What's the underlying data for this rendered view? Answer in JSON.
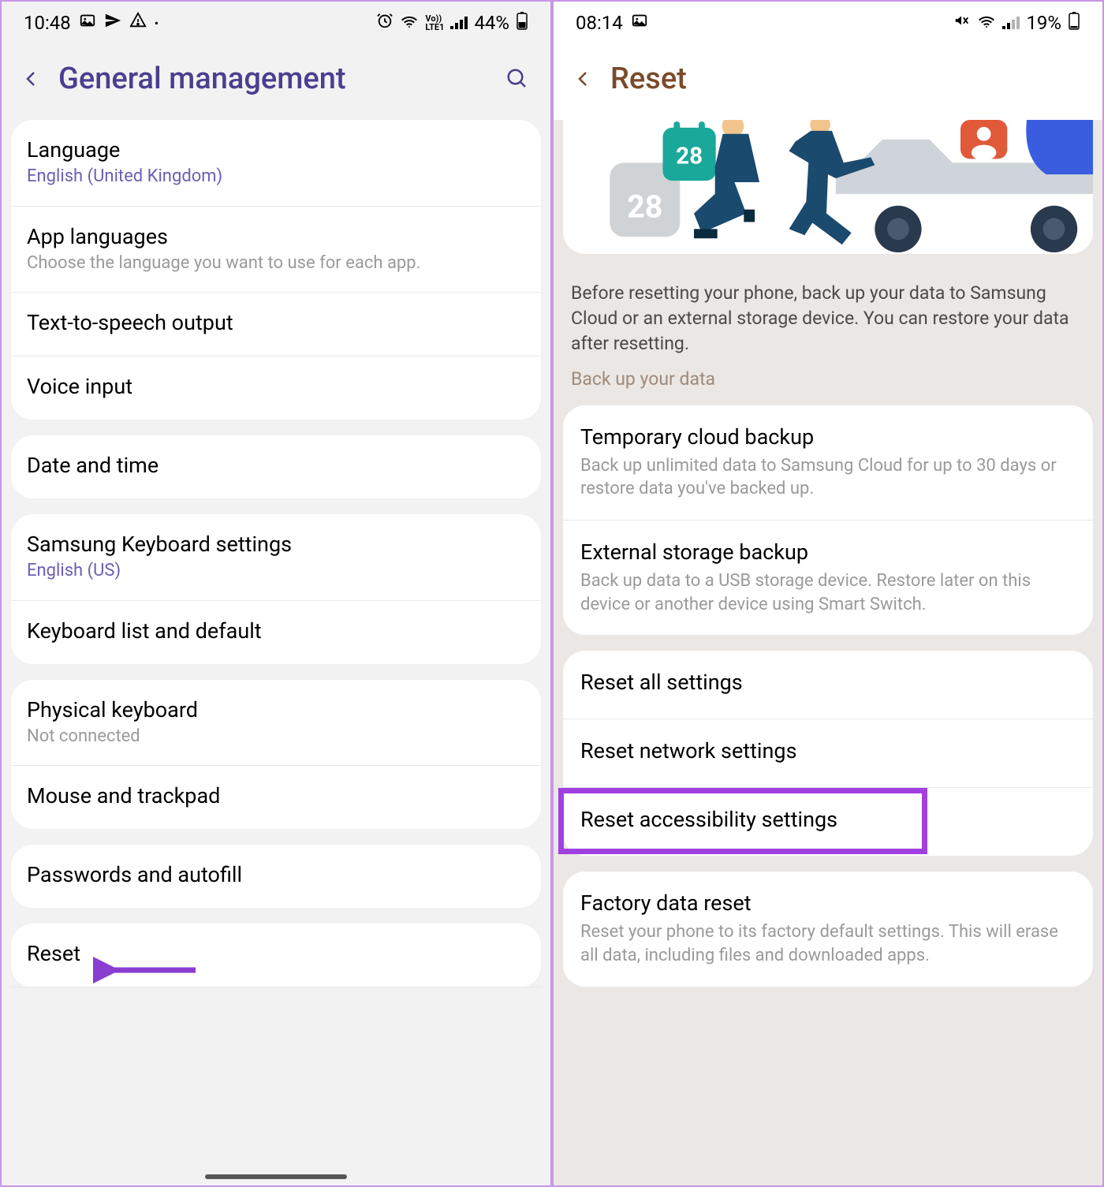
{
  "left": {
    "status": {
      "time": "10:48",
      "battery": "44%"
    },
    "header": {
      "title": "General management"
    },
    "cards": [
      [
        {
          "title": "Language",
          "sub": "English (United Kingdom)",
          "subClass": "purple"
        },
        {
          "title": "App languages",
          "sub": "Choose the language you want to use for each app."
        },
        {
          "title": "Text-to-speech output"
        },
        {
          "title": "Voice input"
        }
      ],
      [
        {
          "title": "Date and time"
        }
      ],
      [
        {
          "title": "Samsung Keyboard settings",
          "sub": "English (US)",
          "subClass": "purple"
        },
        {
          "title": "Keyboard list and default"
        }
      ],
      [
        {
          "title": "Physical keyboard",
          "sub": "Not connected"
        },
        {
          "title": "Mouse and trackpad"
        }
      ],
      [
        {
          "title": "Passwords and autofill"
        }
      ],
      [
        {
          "title": "Reset"
        }
      ]
    ]
  },
  "right": {
    "status": {
      "time": "08:14",
      "battery": "19%"
    },
    "header": {
      "title": "Reset"
    },
    "backupText": "Before resetting your phone, back up your data to Samsung Cloud or an external storage device. You can restore your data after resetting.",
    "backupLink": "Back up your data",
    "backupCard": [
      {
        "title": "Temporary cloud backup",
        "sub": "Back up unlimited data to Samsung Cloud for up to 30 days or restore data you've backed up."
      },
      {
        "title": "External storage backup",
        "sub": "Back up data to a USB storage device. Restore later on this device or another device using Smart Switch."
      }
    ],
    "resetCard": [
      {
        "title": "Reset all settings"
      },
      {
        "title": "Reset network settings"
      },
      {
        "title": "Reset accessibility settings",
        "highlight": true
      }
    ],
    "factoryCard": [
      {
        "title": "Factory data reset",
        "sub": "Reset your phone to its factory default settings. This will erase all data, including files and downloaded apps."
      }
    ]
  }
}
